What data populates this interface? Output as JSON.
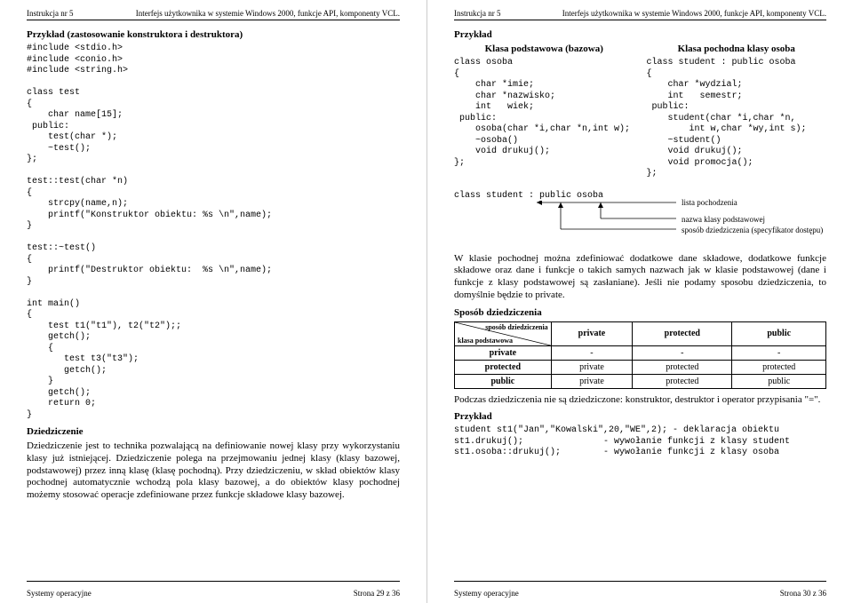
{
  "header": {
    "left": "Instrukcja nr 5",
    "right": "Interfejs użytkownika w systemie Windows 2000, funkcje API, komponenty VCL."
  },
  "footer": {
    "sys": "Systemy operacyjne",
    "left_page": "Strona 29 z 36",
    "right_page": "Strona 30 z 36"
  },
  "left": {
    "title1": "Przykład (zastosowanie konstruktora i destruktora)",
    "code1": "#include <stdio.h>\n#include <conio.h>\n#include <string.h>\n\nclass test\n{\n    char name[15];\n public:\n    test(char *);\n    ~test();\n};\n\ntest::test(char *n)\n{\n    strcpy(name,n);\n    printf(\"Konstruktor obiektu: %s \\n\",name);\n}\n\ntest::~test()\n{\n    printf(\"Destruktor obiektu:  %s \\n\",name);\n}\n\nint main()\n{\n    test t1(\"t1\"), t2(\"t2\");;\n    getch();\n    {\n       test t3(\"t3\");\n       getch();\n    }\n    getch();\n    return 0;\n}",
    "title2": "Dziedziczenie",
    "para1": "Dziedziczenie jest to technika pozwalającą na definiowanie nowej klasy przy wykorzystaniu klasy już istniejącej. Dziedziczenie polega na przejmowaniu jednej klasy (klasy bazowej, podstawowej) przez inną klasę (klasę pochodną). Przy dziedziczeniu, w skład obiektów klasy pochodnej automatycznie wchodzą pola klasy bazowej, a do obiektów klasy pochodnej możemy stosować operacje zdefiniowane przez funkcje składowe klasy bazowej."
  },
  "right": {
    "title1": "Przykład",
    "col_base_head": "Klasa podstawowa (bazowa)",
    "col_der_head": "Klasa pochodna klasy osoba",
    "code_base": "class osoba\n{\n    char *imie;\n    char *nazwisko;\n    int   wiek;\n public:\n    osoba(char *i,char *n,int w);\n    ~osoba()\n    void drukuj();\n};",
    "code_der": "class student : public osoba\n{\n    char *wydzial;\n    int   semestr;\n public:\n    student(char *i,char *n,\n        int w,char *wy,int s);\n    ~student()\n    void drukuj();\n    void promocja();\n};",
    "inherit_line": "class student : public osoba",
    "ann_list": "lista pochodzenia",
    "ann_base": "nazwa klasy podstawowej",
    "ann_spec": "sposób dziedziczenia (specyfikator dostępu)",
    "para1": "W klasie pochodnej można zdefiniować dodatkowe dane składowe, dodatkowe funkcje składowe oraz dane i funkcje o takich samych nazwach jak w klasie podstawowej (dane i funkcje z klasy podstawowej są zasłaniane). Jeśli nie podamy sposobu dziedziczenia, to domyślnie będzie to private.",
    "title2": "Sposób dziedziczenia",
    "tbl": {
      "diag_top": "sposób dziedziczenia",
      "diag_bottom": "klasa podstawowa",
      "cols": [
        "private",
        "protected",
        "public"
      ],
      "rows": [
        {
          "h": "private",
          "c": [
            "-",
            "-",
            "-"
          ]
        },
        {
          "h": "protected",
          "c": [
            "private",
            "protected",
            "protected"
          ]
        },
        {
          "h": "public",
          "c": [
            "private",
            "protected",
            "public"
          ]
        }
      ]
    },
    "para2": "Podczas dziedziczenia nie są dziedziczone: konstruktor, destruktor i operator przypisania \"=\".",
    "title3": "Przykład",
    "code2": "student st1(\"Jan\",\"Kowalski\",20,\"WE\",2); - deklaracja obiektu\nst1.drukuj();               - wywołanie funkcji z klasy student\nst1.osoba::drukuj();        - wywołanie funkcji z klasy osoba"
  }
}
